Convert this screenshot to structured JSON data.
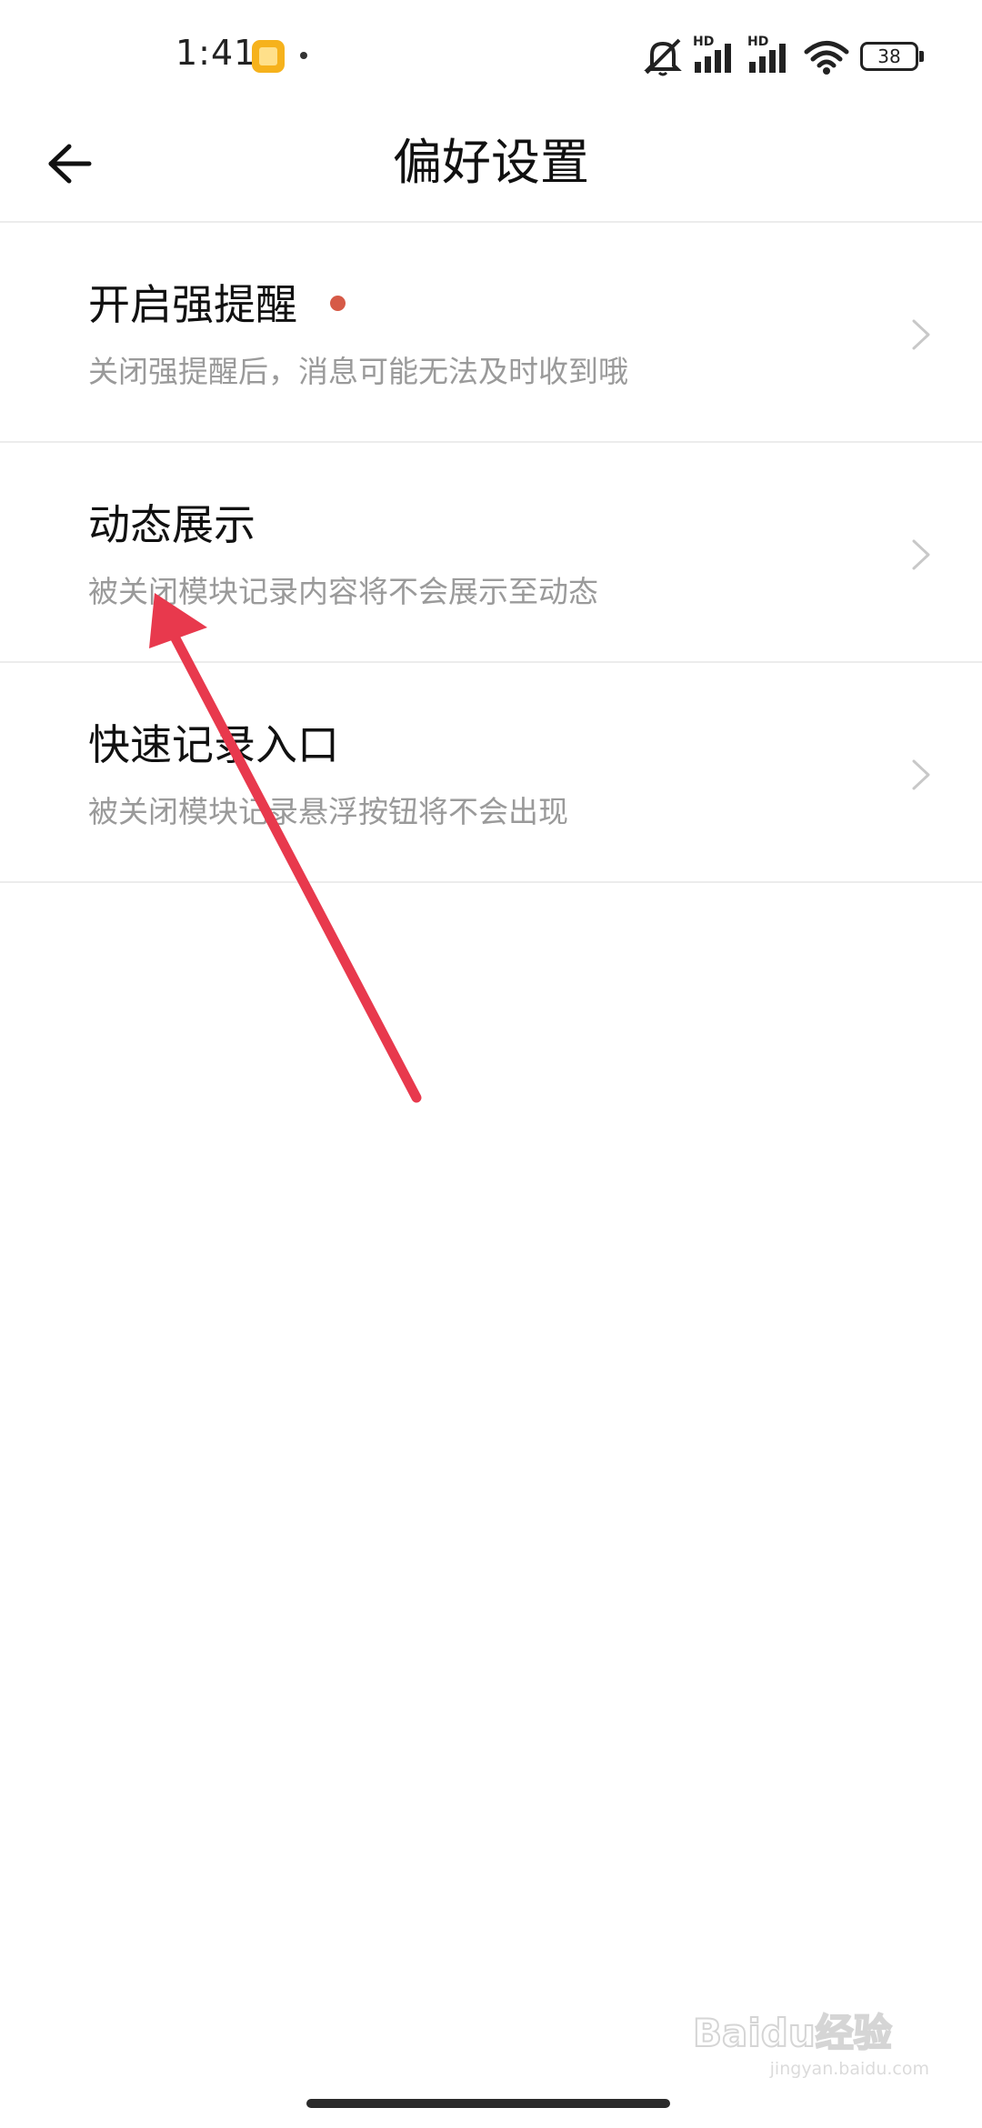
{
  "status_bar": {
    "time": "1:41",
    "battery": "38",
    "signal_1_label": "HD",
    "signal_2_label": "HD",
    "icons": [
      "app-notification-icon",
      "mute-icon",
      "signal-icon",
      "wifi-icon",
      "battery-icon"
    ]
  },
  "header": {
    "title": "偏好设置",
    "back_icon": "arrow-left-icon"
  },
  "settings": {
    "items": [
      {
        "title": "开启强提醒",
        "description": "关闭强提醒后，消息可能无法及时收到哦",
        "has_badge": true
      },
      {
        "title": "动态展示",
        "description": "被关闭模块记录内容将不会展示至动态"
      },
      {
        "title": "快速记录入口",
        "description": "被关闭模块记录悬浮按钮将不会出现"
      }
    ]
  },
  "watermark": {
    "text": "Baidu经验",
    "sub": "jingyan.baidu.com"
  },
  "colors": {
    "badge": "#d65a47",
    "arrow": "#e8394d",
    "divider": "#ececec",
    "description": "#9a9a9a"
  }
}
